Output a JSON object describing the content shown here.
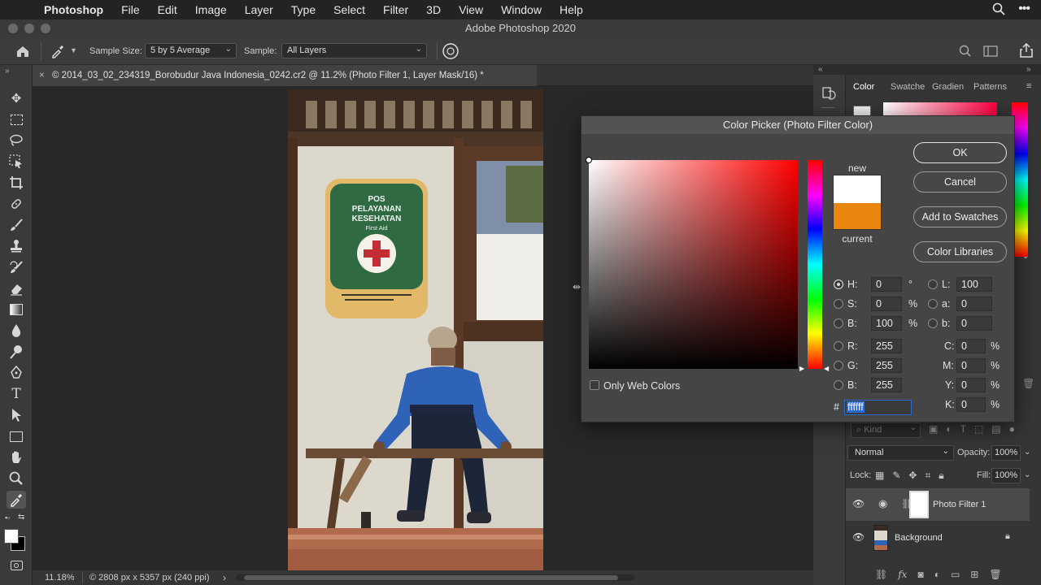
{
  "menubar": {
    "app": "Photoshop",
    "items": [
      "File",
      "Edit",
      "Image",
      "Layer",
      "Type",
      "Select",
      "Filter",
      "3D",
      "View",
      "Window",
      "Help"
    ]
  },
  "window": {
    "title": "Adobe Photoshop 2020"
  },
  "options": {
    "sample_size_label": "Sample Size:",
    "sample_size_value": "5 by 5 Average",
    "sample_label": "Sample:",
    "sample_value": "All Layers"
  },
  "document": {
    "tab_title": "© 2014_03_02_234319_Borobudur Java Indonesia_0242.cr2 @ 11.2% (Photo Filter 1, Layer Mask/16) *"
  },
  "status": {
    "zoom": "11.18%",
    "info": "© 2808 px x 5357 px (240 ppi)"
  },
  "panel_tabs": [
    "Color",
    "Swatche",
    "Gradien",
    "Patterns"
  ],
  "layers": {
    "kind_placeholder": "Kind",
    "blend_mode": "Normal",
    "opacity_label": "Opacity:",
    "opacity_value": "100%",
    "lock_label": "Lock:",
    "fill_label": "Fill:",
    "fill_value": "100%",
    "items": [
      {
        "name": "Photo Filter 1"
      },
      {
        "name": "Background"
      }
    ]
  },
  "dialog": {
    "title": "Color Picker (Photo Filter Color)",
    "new_label": "new",
    "current_label": "current",
    "new_color": "#ffffff",
    "current_color": "#e8860e",
    "buttons": {
      "ok": "OK",
      "cancel": "Cancel",
      "add_swatches": "Add to Swatches",
      "color_libraries": "Color Libraries"
    },
    "only_web_colors": "Only Web Colors",
    "hsb": {
      "h_label": "H:",
      "h": "0",
      "h_unit": "°",
      "s_label": "S:",
      "s": "0",
      "s_unit": "%",
      "b_label": "B:",
      "b": "100",
      "b_unit": "%"
    },
    "rgb": {
      "r_label": "R:",
      "r": "255",
      "g_label": "G:",
      "g": "255",
      "b_label": "B:",
      "b": "255"
    },
    "lab": {
      "l_label": "L:",
      "l": "100",
      "a_label": "a:",
      "a": "0",
      "b_label": "b:",
      "b": "0"
    },
    "cmyk": {
      "c_label": "C:",
      "c": "0",
      "m_label": "M:",
      "m": "0",
      "y_label": "Y:",
      "y": "0",
      "k_label": "K:",
      "k": "0",
      "unit": "%"
    },
    "hex_label": "#",
    "hex": "ffffff"
  },
  "icons": [
    "apple-icon",
    "search-icon",
    "menu-dots-icon",
    "home-icon",
    "eyedropper-icon",
    "target-icon",
    "move-icon",
    "marquee-icon",
    "lasso-icon",
    "crop-icon",
    "brush-icon",
    "eye-icon"
  ]
}
